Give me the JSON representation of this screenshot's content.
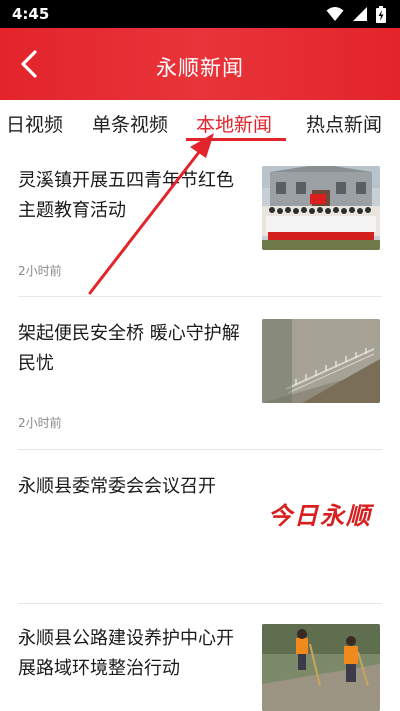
{
  "status": {
    "time": "4:45"
  },
  "header": {
    "title": "永顺新闻"
  },
  "tabs": [
    {
      "label": "日视频"
    },
    {
      "label": "单条视频"
    },
    {
      "label": "本地新闻",
      "active": true
    },
    {
      "label": "热点新闻"
    }
  ],
  "news": [
    {
      "title": "灵溪镇开展五四青年节红色主题教育活动",
      "time": "2小时前"
    },
    {
      "title": "架起便民安全桥 暖心守护解民忧",
      "time": "2小时前"
    },
    {
      "title": "永顺县委常委会会议召开",
      "logo_text": "今日永顺"
    },
    {
      "title": "永顺县公路建设养护中心开展路域环境整治行动"
    }
  ],
  "colors": {
    "accent": "#e3242b",
    "header_bg": "#e3242b",
    "status_bg": "#000000"
  }
}
